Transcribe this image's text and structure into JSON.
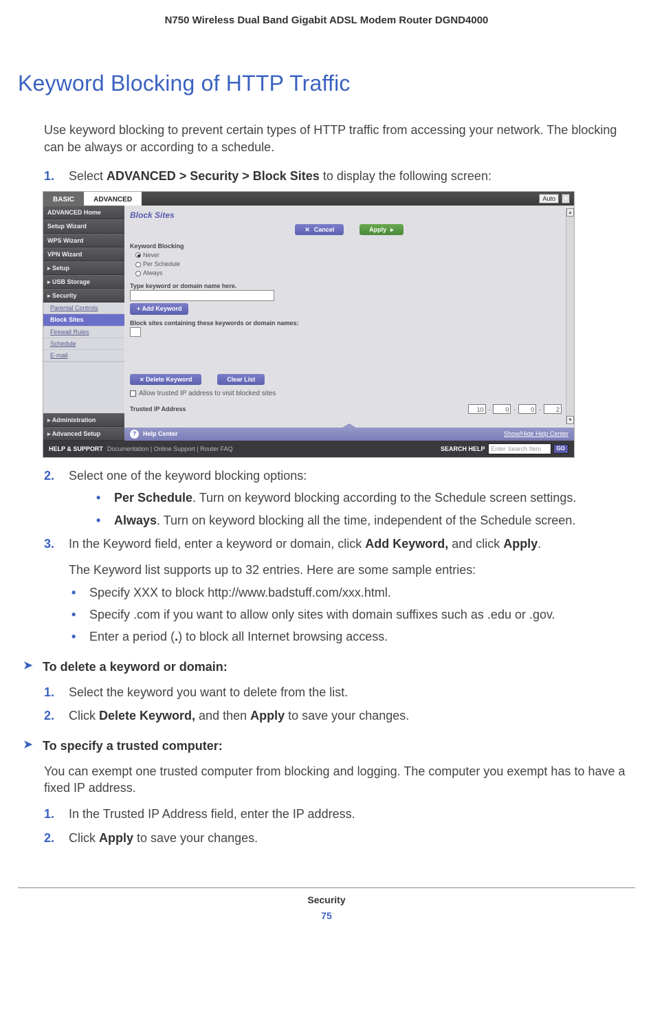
{
  "header": "N750 Wireless Dual Band Gigabit ADSL Modem Router DGND4000",
  "title": "Keyword Blocking of HTTP Traffic",
  "intro": "Use keyword blocking to prevent certain types of HTTP traffic from accessing your network. The blocking can be always or according to a schedule.",
  "step1": {
    "num": "1.",
    "pre": "Select ",
    "path": "ADVANCED > Security > Block Sites",
    "post": " to display the following screen:"
  },
  "ui": {
    "tabs": {
      "basic": "BASIC",
      "advanced": "ADVANCED"
    },
    "auto": "Auto",
    "sidebar": {
      "home": "ADVANCED Home",
      "setup_wizard": "Setup Wizard",
      "wps": "WPS Wizard",
      "vpn": "VPN Wizard",
      "setup": "Setup",
      "usb": "USB Storage",
      "security": "Security",
      "sub": {
        "parental": "Parental Controls",
        "block": "Block Sites",
        "firewall": "Firewall Rules",
        "schedule": "Schedule",
        "email": "E-mail"
      },
      "admin": "Administration",
      "advsetup": "Advanced Setup"
    },
    "content": {
      "title": "Block Sites",
      "cancel": "Cancel",
      "apply": "Apply",
      "kw_label": "Keyword Blocking",
      "opt_never": "Never",
      "opt_per": "Per Schedule",
      "opt_always": "Always",
      "type_label": "Type keyword or domain name here.",
      "add_kw": "Add Keyword",
      "block_list_label": "Block sites containing these keywords or domain names:",
      "delete_kw": "Delete Keyword",
      "clear_list": "Clear List",
      "allow_trusted": "Allow trusted IP address to visit blocked sites",
      "trusted_label": "Trusted IP Address",
      "ip": [
        "10",
        "0",
        "0",
        "2"
      ]
    },
    "help_center": "Help Center",
    "show_hide": "Show/Hide Help Center",
    "bottom": {
      "hs": "HELP & SUPPORT",
      "links": "Documentation | Online Support | Router FAQ",
      "search_label": "SEARCH HELP",
      "placeholder": "Enter Search Item",
      "go": "GO"
    }
  },
  "step2": {
    "num": "2.",
    "text": "Select one of the keyword blocking options:",
    "b1_term": "Per Schedule",
    "b1_rest": ". Turn on keyword blocking according to the Schedule screen settings.",
    "b2_term": "Always",
    "b2_rest": ". Turn on keyword blocking all the time, independent of the Schedule screen."
  },
  "step3": {
    "num": "3.",
    "pre": "In the Keyword field, enter a keyword or domain, click ",
    "b1": "Add Keyword,",
    "mid": " and click ",
    "b2": "Apply",
    "post": ".",
    "para": "The Keyword list supports up to 32 entries. Here are some sample entries:",
    "s1": "Specify XXX to block http://www.badstuff.com/xxx.html.",
    "s2": "Specify .com if you want to allow only sites with domain suffixes such as .edu or .gov.",
    "s3_pre": "Enter a period (",
    "s3_dot": ".",
    "s3_post": ") to block all Internet browsing access."
  },
  "taskA": {
    "heading": "To delete a keyword or domain:",
    "s1": {
      "num": "1.",
      "text": "Select the keyword you want to delete from the list."
    },
    "s2": {
      "num": "2.",
      "pre": "Click ",
      "b1": "Delete Keyword,",
      "mid": " and then ",
      "b2": "Apply",
      "post": " to save your changes."
    }
  },
  "taskB": {
    "heading": "To specify a trusted computer:",
    "intro": "You can exempt one trusted computer from blocking and logging. The computer you exempt has to have a fixed IP address.",
    "s1": {
      "num": "1.",
      "text": "In the Trusted IP Address field, enter the IP address."
    },
    "s2": {
      "num": "2.",
      "pre": "Click ",
      "b1": "Apply",
      "post": " to save your changes."
    }
  },
  "footer": {
    "section": "Security",
    "page": "75"
  }
}
